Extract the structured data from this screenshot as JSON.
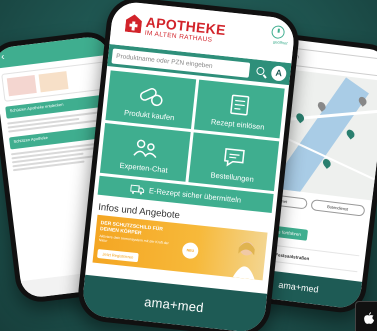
{
  "center": {
    "logo_title": "APOTHEKE",
    "logo_subtitle": "IM ALTEN RATHAUS",
    "clock_label": "geöffnet",
    "search_placeholder": "Produktname oder PZN eingeben",
    "account_badge": "A",
    "tiles": [
      {
        "label": "Produkt kaufen",
        "icon": "pills-icon"
      },
      {
        "label": "Rezept einlösen",
        "icon": "prescription-icon"
      },
      {
        "label": "Experten-Chat",
        "icon": "chat-people-icon"
      },
      {
        "label": "Bestellungen",
        "icon": "orders-chat-icon"
      }
    ],
    "wide_tile": {
      "label": "E-Rezept sicher übermitteln",
      "icon": "truck-icon"
    },
    "section_title": "Infos und Angebote",
    "banner": {
      "headline": "Der Schutzschild für deinen Körper",
      "subtext": "Aktiviere dein Immunsystem mit der Kraft der Natur",
      "button": "Jetzt Registrieren",
      "badge": "NEU"
    },
    "brand": "ama+med"
  },
  "left": {
    "rows": [
      {
        "strip": "Schützen Apotheke entdecken"
      },
      {
        "strip": "Schützen Apotheke"
      }
    ]
  },
  "right": {
    "search_value": "Apotheken",
    "pills": [
      "Geöffnet",
      "Botendienst"
    ],
    "result_name": "Apotheke",
    "result_distance": "Schillerstraße",
    "result_button": "mit Apotheke fortfahren",
    "result2_name": "Apotheke am Festsaalstraßen",
    "brand": "ama+med"
  },
  "colors": {
    "accent_green": "#3fae8f",
    "dark_teal": "#1e5b55",
    "logo_red": "#d2232a",
    "banner_orange": "#f4a623"
  }
}
